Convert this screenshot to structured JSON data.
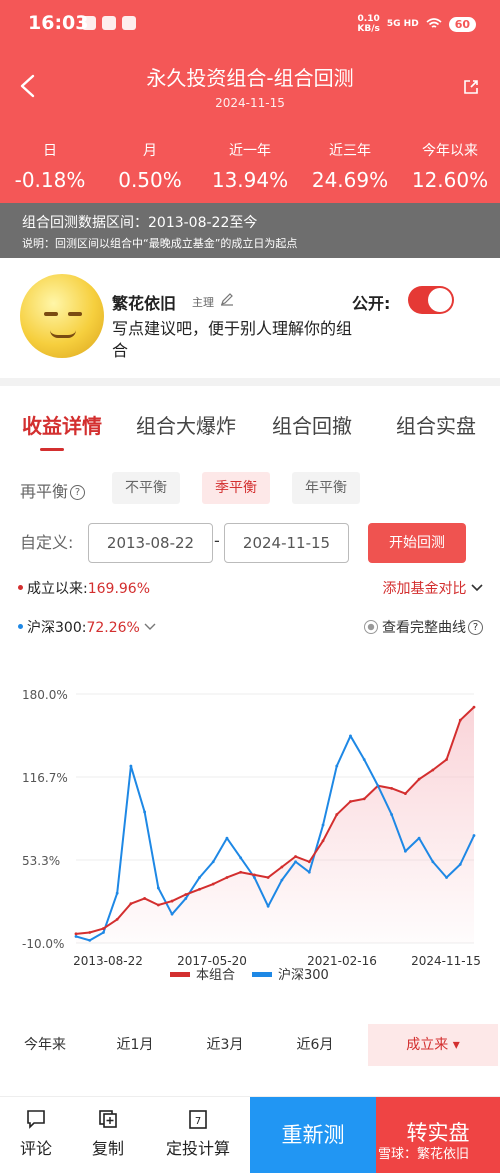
{
  "status_bar": {
    "time": "16:03",
    "speed_top": "0.10",
    "speed_bottom": "KB/s",
    "signal": "5G HD",
    "battery": "60"
  },
  "header": {
    "title": "永久投资组合-组合回测",
    "date": "2024-11-15",
    "returns": [
      {
        "label": "日",
        "value": "-0.18%"
      },
      {
        "label": "月",
        "value": "0.50%"
      },
      {
        "label": "近一年",
        "value": "13.94%"
      },
      {
        "label": "近三年",
        "value": "24.69%"
      },
      {
        "label": "今年以来",
        "value": "12.60%"
      }
    ]
  },
  "notice": {
    "range": "组合回测数据区间：2013-08-22至今",
    "note": "说明：回测区间以组合中“最晚成立基金”的成立日为起点"
  },
  "profile": {
    "name": "繁花依旧",
    "role": "主理",
    "description": "写点建议吧，便于别人理解你的组合",
    "public_label": "公开:",
    "public_on": true
  },
  "tabs": [
    "收益详情",
    "组合大爆炸",
    "组合回撤",
    "组合实盘"
  ],
  "rebalance": {
    "label": "再平衡",
    "options": [
      "不平衡",
      "季平衡",
      "年平衡"
    ],
    "selected": "季平衡"
  },
  "custom": {
    "label": "自定义:",
    "start": "2013-08-22",
    "end": "2024-11-15",
    "button": "开始回测"
  },
  "since": {
    "label": "成立以来:",
    "value": "169.96%",
    "add_fund": "添加基金对比"
  },
  "benchmark": {
    "label": "沪深300:",
    "value": "72.26%",
    "full_curve": "查看完整曲线"
  },
  "ranges": [
    "今年来",
    "近1月",
    "近3月",
    "近6月",
    "成立来"
  ],
  "bottom_bar": {
    "comment": "评论",
    "copy": "复制",
    "calc": "定投计算",
    "retest": "重新测",
    "to_real": "转实盘"
  },
  "watermark": "雪球：繁花依旧",
  "colors": {
    "header": "#f45757",
    "portfolio": "#d32f2f",
    "benchmark": "#1e88e5",
    "retest": "#2196f3",
    "real": "#ef4444"
  },
  "chart_data": {
    "type": "line",
    "ylim": [
      -10.0,
      180.0
    ],
    "y_ticks": [
      "180.0%",
      "116.7%",
      "53.3%",
      "-10.0%"
    ],
    "x_ticks": [
      "2013-08-22",
      "2017-05-20",
      "2021-02-16",
      "2024-11-15"
    ],
    "x": [
      "2013-08",
      "2014-02",
      "2014-08",
      "2015-02",
      "2015-05",
      "2015-06",
      "2015-09",
      "2016-02",
      "2016-08",
      "2017-02",
      "2017-05",
      "2017-11",
      "2018-02",
      "2018-06",
      "2018-12",
      "2019-04",
      "2019-12",
      "2020-03",
      "2020-07",
      "2020-12",
      "2021-02",
      "2021-06",
      "2021-12",
      "2022-04",
      "2022-10",
      "2023-03",
      "2023-10",
      "2024-02",
      "2024-09",
      "2024-11"
    ],
    "series": [
      {
        "name": "本组合",
        "values": [
          -3,
          -2,
          1,
          8,
          20,
          24,
          19,
          22,
          27,
          31,
          35,
          40,
          44,
          42,
          40,
          48,
          56,
          52,
          68,
          88,
          98,
          100,
          110,
          108,
          104,
          115,
          122,
          130,
          160,
          170
        ]
      },
      {
        "name": "沪深300",
        "values": [
          -5,
          -8,
          -2,
          28,
          125,
          90,
          32,
          12,
          24,
          40,
          52,
          70,
          55,
          40,
          18,
          38,
          52,
          44,
          80,
          125,
          148,
          130,
          110,
          88,
          60,
          70,
          52,
          40,
          50,
          72
        ]
      }
    ]
  }
}
